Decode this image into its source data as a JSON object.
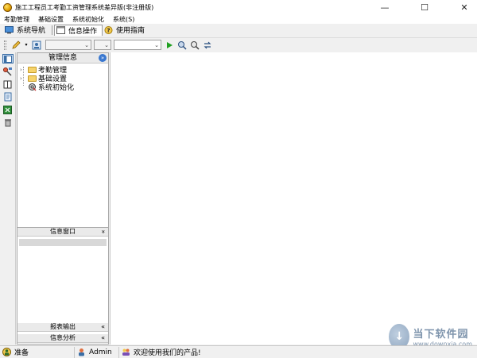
{
  "window": {
    "title": "施工工程员工考勤工资管理系统差异版(非注册版)",
    "minimize": "—",
    "maximize": "☐",
    "close": "✕"
  },
  "menu": [
    "考勤管理",
    "基础设置",
    "系统初始化",
    "系统(S)"
  ],
  "nav_tabs": [
    {
      "label": "系统导航",
      "icon": "monitor-icon"
    },
    {
      "label": "信息操作",
      "icon": "window-icon"
    },
    {
      "label": "使用指南",
      "icon": "help-icon"
    }
  ],
  "left_panel": {
    "title": "管理信息",
    "tree": [
      {
        "label": "考勤管理",
        "icon": "folder-icon",
        "expander": "›"
      },
      {
        "label": "基础设置",
        "icon": "folder-icon",
        "expander": "›"
      },
      {
        "label": "系统初始化",
        "icon": "settings-icon"
      }
    ],
    "info_window": "信息窗口",
    "report_output": "报表输出",
    "info_analysis": "信息分析",
    "expand_glyph": "»",
    "collapse_glyph": "«"
  },
  "status": {
    "ready": "准备",
    "user": "Admin",
    "message": "欢迎使用我们的产品!"
  },
  "watermark": {
    "name": "当下软件园",
    "url": "www.downxia.com"
  },
  "colors": {
    "accent": "#3a78d0",
    "folder": "#f6d36a",
    "play": "#20a020"
  }
}
